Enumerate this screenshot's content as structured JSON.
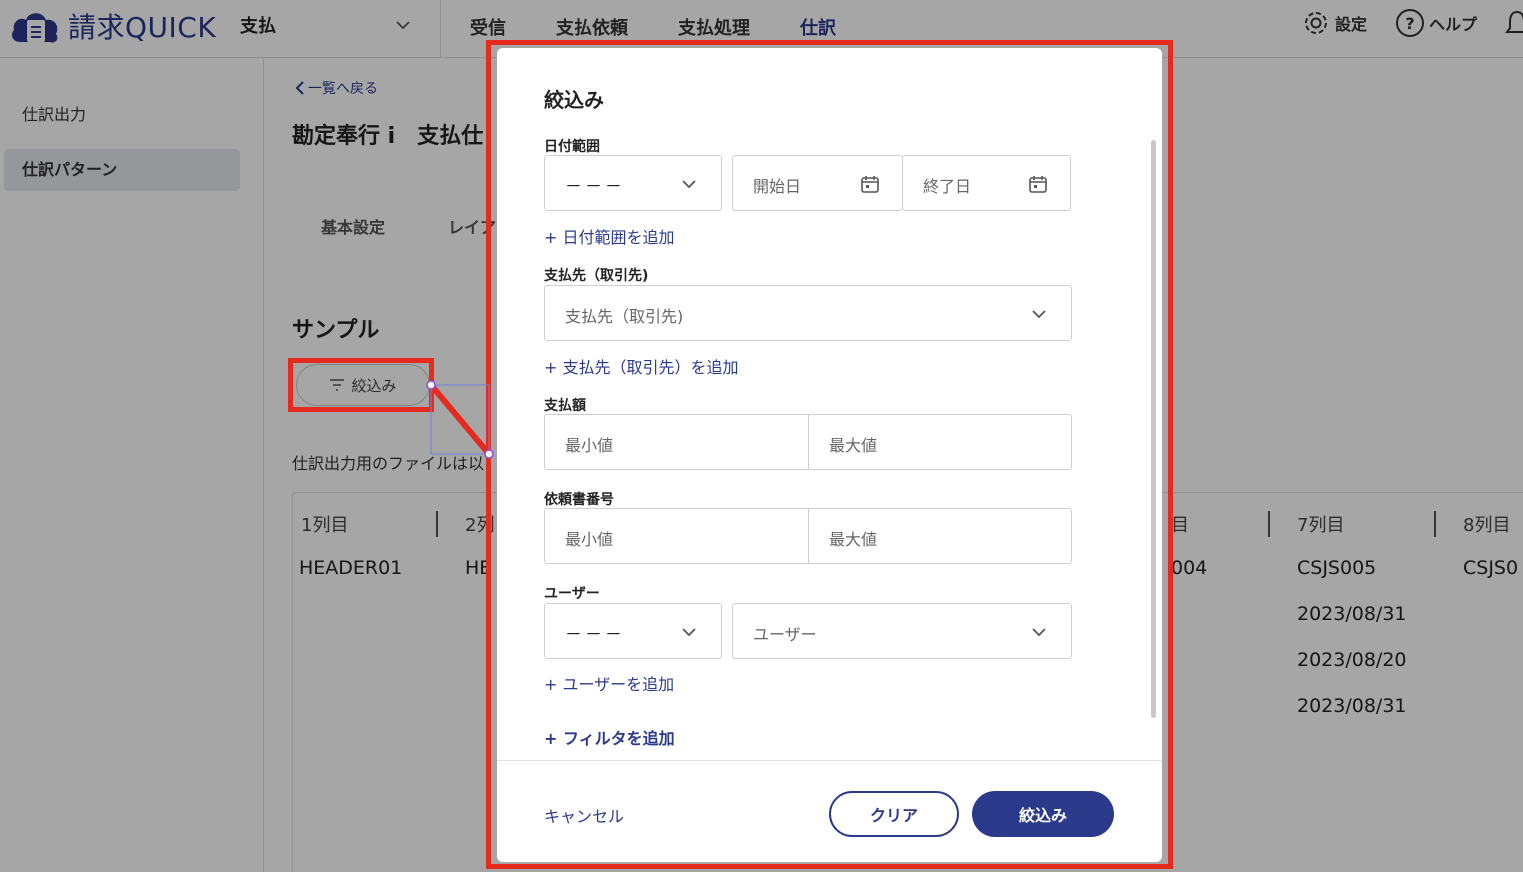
{
  "app": {
    "logo_text": "請求QUICK",
    "product": "支払"
  },
  "nav": {
    "tabs": [
      {
        "label": "受信",
        "active": false
      },
      {
        "label": "支払依頼",
        "active": false
      },
      {
        "label": "支払処理",
        "active": false
      },
      {
        "label": "仕訳",
        "active": true
      }
    ],
    "settings": "設定",
    "help": "ヘルプ"
  },
  "sidebar": {
    "items": [
      {
        "label": "仕訳出力",
        "active": false
      },
      {
        "label": "仕訳パターン",
        "active": true
      }
    ]
  },
  "page": {
    "back": "一覧へ戻る",
    "title": "勘定奉行 i　支払仕",
    "subtabs": [
      "基本設定",
      "レイア"
    ],
    "section": "サンプル",
    "filter_button": "絞込み",
    "description": "仕訳出力用のファイルは以",
    "table": {
      "headers": [
        "1列目",
        "2列",
        "目",
        "7列目",
        "8列目"
      ],
      "row1": [
        "HEADER01",
        "HE",
        "004",
        "CSJS005",
        "CSJS0"
      ],
      "dates": [
        "2023/08/31",
        "2023/08/20",
        "2023/08/31"
      ]
    }
  },
  "modal": {
    "title": "絞込み",
    "date_range": {
      "label": "日付範囲",
      "type_value": "－－－",
      "start_placeholder": "開始日",
      "end_placeholder": "終了日",
      "add": "日付範囲を追加"
    },
    "payee": {
      "label": "支払先（取引先)",
      "placeholder": "支払先（取引先)",
      "add": "支払先（取引先）を追加"
    },
    "amount": {
      "label": "支払額",
      "min_placeholder": "最小値",
      "max_placeholder": "最大値"
    },
    "request_no": {
      "label": "依頼書番号",
      "min_placeholder": "最小値",
      "max_placeholder": "最大値"
    },
    "user": {
      "label": "ユーザー",
      "type_value": "－－－",
      "placeholder": "ユーザー",
      "add": "ユーザーを追加"
    },
    "add_filter": "フィルタを追加",
    "add_prefix": "+",
    "footer": {
      "cancel": "キャンセル",
      "clear": "クリア",
      "apply": "絞込み"
    }
  },
  "colors": {
    "brand": "#2c3a8c",
    "annotation": "#e52b20"
  }
}
